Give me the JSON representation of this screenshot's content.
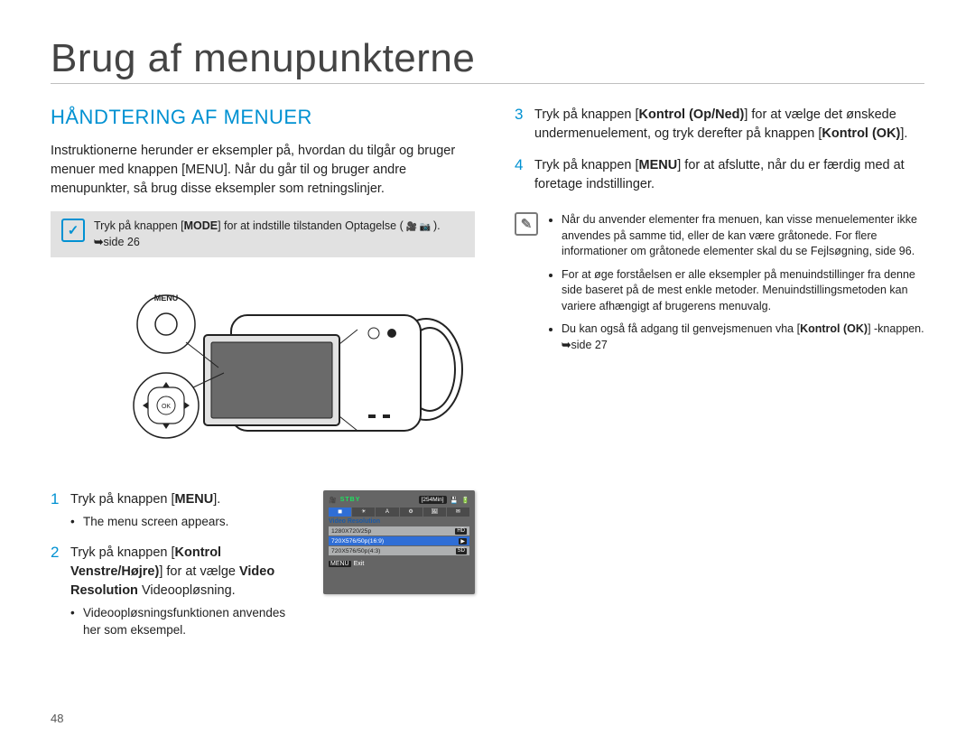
{
  "title": "Brug af menupunkterne",
  "section_heading": "HÅNDTERING AF MENUER",
  "intro": "Instruktionerne herunder er eksempler på, hvordan du tilgår og bruger menuer med knappen [MENU]. Når du går til og bruger andre menupunkter, så brug disse eksempler som retningslinjer.",
  "note_left_part1": "Tryk på knappen [",
  "note_left_mode": "MODE",
  "note_left_part2": "] for at indstille tilstanden Optagelse (",
  "note_left_icons": " 🎥 📷 ",
  "note_left_part3": "). ",
  "note_left_arrow": "➥",
  "note_left_part4": "side 26",
  "illus_labels": {
    "menu": "MENU",
    "ok": "OK"
  },
  "steps": {
    "s1": {
      "text_a": "Tryk på knappen [",
      "text_b": "MENU",
      "text_c": "].",
      "sub": "The menu screen appears."
    },
    "s2": {
      "text_a": "Tryk på knappen [",
      "text_b": "Kontrol Venstre/Højre)",
      "text_c": "] for at vælge ",
      "text_d": "Video Resolution",
      "text_e": " Videoopløsning.",
      "sub": "Videoopløsningsfunktionen anvendes her som eksempel."
    },
    "s3": {
      "text_a": "Tryk på knappen [",
      "text_b": "Kontrol (Op/Ned)",
      "text_c": "] for at vælge det ønskede undermenuelement, og tryk derefter på knappen [",
      "text_d": "Kontrol (OK)",
      "text_e": "]."
    },
    "s4": {
      "text_a": "Tryk på knappen [",
      "text_b": "MENU",
      "text_c": "] for at afslutte, når du er færdig med at foretage indstillinger."
    }
  },
  "mini": {
    "stby": "STBY",
    "time": "[254Min]",
    "vr": "Video Resolution",
    "opt1": "1280X720/25p",
    "opt1_q": "HD",
    "opt2": "720X576/50p(16:9)",
    "opt2_q": "▶",
    "opt3": "720X576/50p(4:3)",
    "opt3_q": "SD",
    "menu": "MENU",
    "exit": "Exit"
  },
  "right_notes": {
    "n1": "Når du anvender elementer fra menuen, kan visse menuelementer ikke anvendes på samme tid, eller de kan være gråtonede. For flere informationer om gråtonede elementer skal du se Fejlsøgning, side 96.",
    "n2": "For at øge forståelsen er alle eksempler på menuindstillinger fra denne side baseret på de mest enkle metoder. Menuindstillingsmetoden kan variere afhængigt af brugerens menuvalg.",
    "n3_a": "Du kan også få adgang til genvejsmenuen vha [",
    "n3_b": "Kontrol (OK)",
    "n3_c": "] -knappen. ",
    "n3_arrow": "➥",
    "n3_d": "side 27"
  },
  "page_number": "48"
}
